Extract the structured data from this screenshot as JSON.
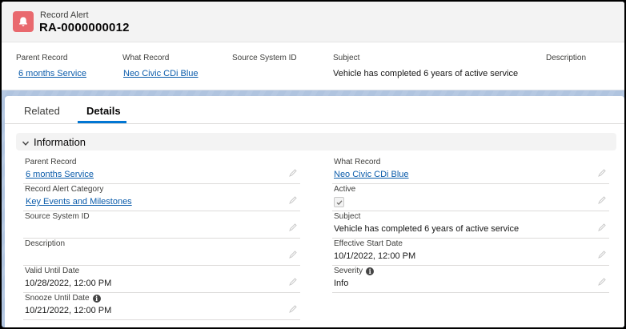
{
  "header": {
    "object_label": "Record Alert",
    "record_name": "RA-0000000012",
    "fields": [
      {
        "label": "Parent Record",
        "value": "6 months Service"
      },
      {
        "label": "What Record",
        "value": "Neo Civic CDi Blue"
      },
      {
        "label": "Source System ID",
        "value": ""
      },
      {
        "label": "Subject",
        "value": "Vehicle has completed 6 years of active service"
      },
      {
        "label": "Description",
        "value": ""
      }
    ]
  },
  "tabs": {
    "related": "Related",
    "details": "Details"
  },
  "section": {
    "title": "Information"
  },
  "left_fields": [
    {
      "label": "Parent Record",
      "value": "6 months Service"
    },
    {
      "label": "Record Alert Category",
      "value": "Key Events and Milestones"
    },
    {
      "label": "Source System ID",
      "value": ""
    },
    {
      "label": "Description",
      "value": ""
    },
    {
      "label": "Valid Until Date",
      "value": "10/28/2022, 12:00 PM"
    },
    {
      "label": "Snooze Until Date",
      "value": "10/21/2022, 12:00 PM"
    }
  ],
  "right_fields": [
    {
      "label": "What Record",
      "value": "Neo Civic CDi Blue"
    },
    {
      "label": "Active",
      "value": true
    },
    {
      "label": "Subject",
      "value": "Vehicle has completed 6 years of active service"
    },
    {
      "label": "Effective Start Date",
      "value": "10/1/2022, 12:00 PM"
    },
    {
      "label": "Severity",
      "value": "Info"
    }
  ],
  "colors": {
    "icon": "#e9696e",
    "link": "#0b5cab",
    "tab_active": "#0176d3"
  },
  "icons": {
    "object": "bell-icon",
    "section": "chevron-down-icon",
    "edit": "pencil-icon",
    "help": "info-icon"
  }
}
